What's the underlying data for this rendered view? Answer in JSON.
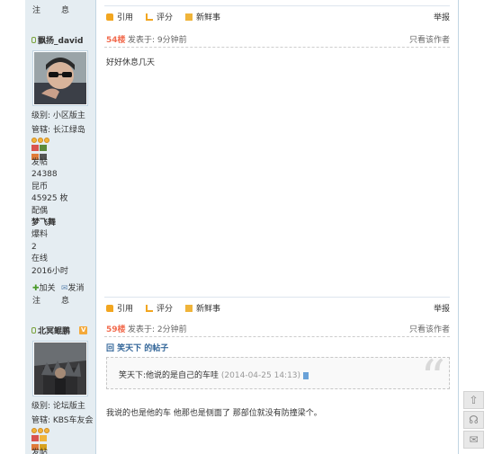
{
  "orphan_contact": {
    "left": "注",
    "right": "息"
  },
  "action_bar": {
    "quote": "引用",
    "rate": "评分",
    "news": "新鲜事",
    "report": "举报"
  },
  "posts": [
    {
      "floor": "54楼",
      "posted": "发表于: 9分钟前",
      "only_author": "只看该作者",
      "body": "好好休息几天",
      "user": {
        "name": "飘扬_david",
        "level": "级别: 小区版主",
        "manage": "管辖: 长江绿岛",
        "stats": [
          "发帖",
          "24388",
          "昆币",
          "45925 枚",
          "配偶",
          "梦飞舞",
          "爆料",
          "2",
          "在线",
          "2016小时"
        ],
        "add_friend": "加关",
        "send_msg": "发消",
        "contact_left": "注",
        "contact_right": "息"
      }
    },
    {
      "floor": "59楼",
      "posted": "发表于: 2分钟前",
      "only_author": "只看该作者",
      "quote_title": "回 笑天下 的帖子",
      "quote_text": "笑天下:他说的是自己的车哇",
      "quote_time": "(2014-04-25 14:13)",
      "body": "我说的也是他的车 他那也是侧面了 那部位就没有防撞梁个。",
      "user": {
        "name": "北冥鲲鹏",
        "vip": "V",
        "level": "级别: 论坛版主",
        "manage": "管辖: KBS车友会",
        "stats_partial": "发帖"
      }
    }
  ],
  "side_tools": [
    "back-to-top",
    "customer-service",
    "wechat"
  ]
}
